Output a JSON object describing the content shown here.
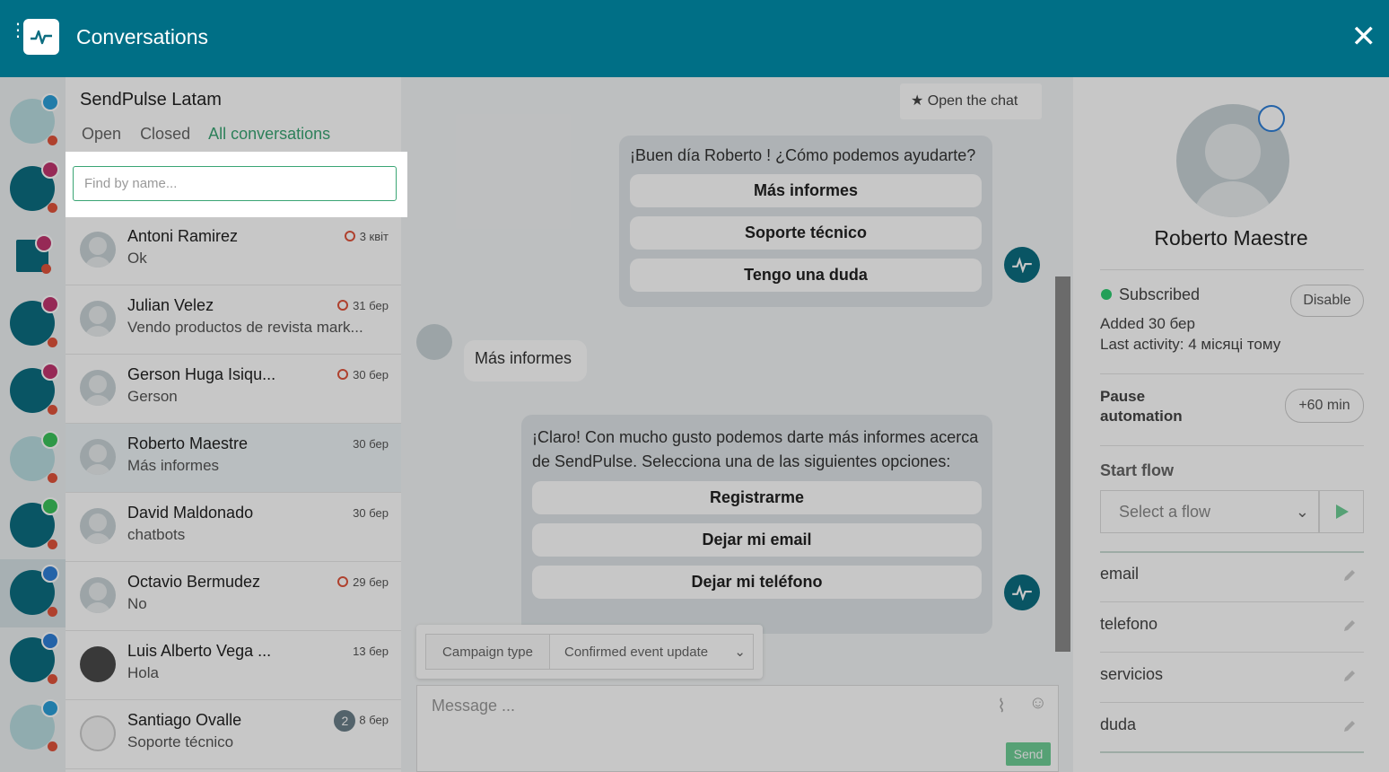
{
  "app": {
    "title": "Conversations"
  },
  "org": {
    "name": "SendPulse Latam"
  },
  "tabs": [
    {
      "label": "Open"
    },
    {
      "label": "Closed"
    },
    {
      "label": "All conversations"
    }
  ],
  "search": {
    "placeholder": "Find by name..."
  },
  "conversations": [
    {
      "name": "Antoni Ramirez",
      "message": "Ok",
      "date": "3 квіт",
      "unread_ring": true
    },
    {
      "name": "Julian Velez",
      "message": "Vendo productos de revista mark...",
      "date": "31 бер",
      "unread_ring": true
    },
    {
      "name": "Gerson Huga Isiqu...",
      "message": "Gerson",
      "date": "30 бер",
      "unread_ring": true
    },
    {
      "name": "Roberto Maestre",
      "message": "Más informes",
      "date": "30 бер",
      "unread_ring": false
    },
    {
      "name": "David Maldonado",
      "message": "chatbots",
      "date": "30 бер",
      "unread_ring": false
    },
    {
      "name": "Octavio Bermudez",
      "message": "No",
      "date": "29 бер",
      "unread_ring": true
    },
    {
      "name": "Luis Alberto Vega ...",
      "message": "Hola",
      "date": "13 бер",
      "unread_ring": false
    },
    {
      "name": "Santiago Ovalle",
      "message": "Soporte técnico",
      "date": "8 бер",
      "count": "2"
    }
  ],
  "chat": {
    "open_chat_label": "Open the chat",
    "bot_message_1": {
      "text": "¡Buen día Roberto ! ¿Cómo podemos ayudarte?",
      "buttons": [
        "Más informes",
        "Soporte técnico",
        "Tengo una duda"
      ]
    },
    "user_message": "Más informes",
    "bot_message_2": {
      "text": "¡Claro! Con mucho gusto podemos darte más informes acerca de SendPulse. Selecciona una de las siguientes opciones:",
      "buttons": [
        "Registrarme",
        "Dejar mi email",
        "Dejar mi teléfono"
      ]
    },
    "campaign_type_label": "Campaign type",
    "campaign_type_value": "Confirmed event update",
    "message_placeholder": "Message ...",
    "send_label": "Send"
  },
  "profile": {
    "name": "Roberto Maestre",
    "status": "Subscribed",
    "disable_label": "Disable",
    "added": "Added 30 бер",
    "last_activity": "Last activity: 4 місяці тому",
    "pause_label": "Pause automation",
    "pause_value": "+60 min",
    "start_flow_label": "Start flow",
    "flow_placeholder": "Select a flow",
    "fields": [
      "email",
      "telefono",
      "servicios",
      "duda"
    ]
  },
  "colors": {
    "topbar": "#006f86",
    "accent": "#3aa574",
    "status_dot": "#e0543c",
    "subscribed": "#2ecc71"
  }
}
